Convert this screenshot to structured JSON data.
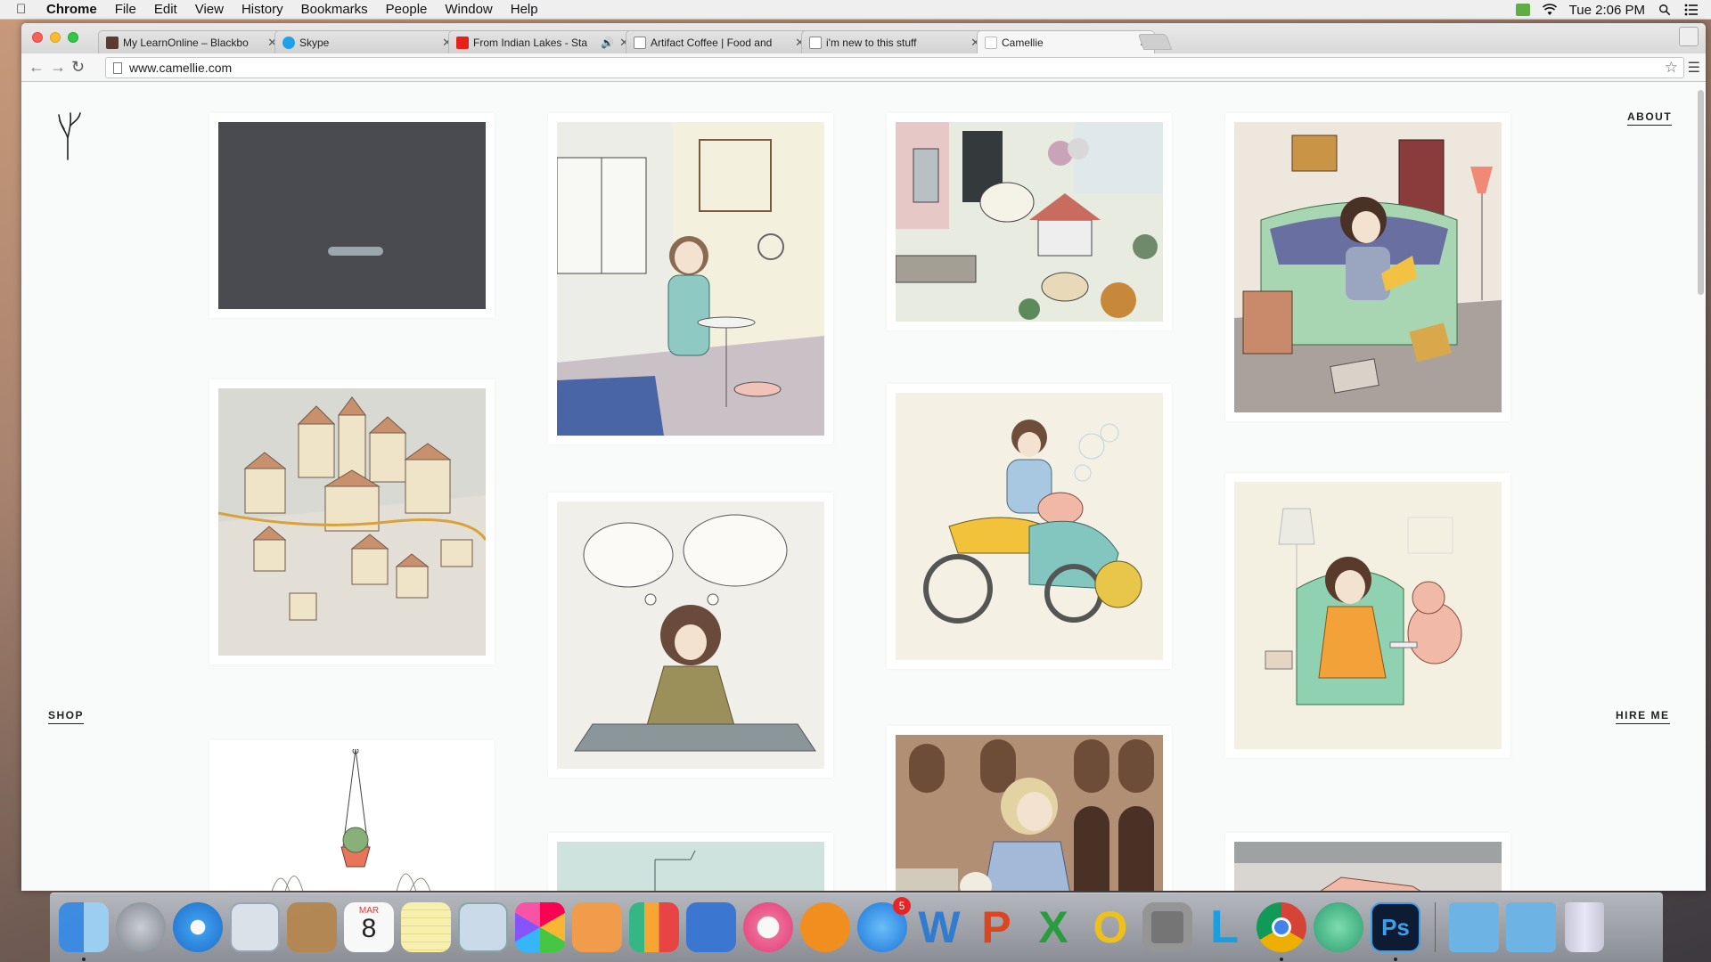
{
  "menubar": {
    "app": "Chrome",
    "items": [
      "File",
      "Edit",
      "View",
      "History",
      "Bookmarks",
      "People",
      "Window",
      "Help"
    ],
    "clock": "Tue 2:06 PM"
  },
  "tabs": [
    {
      "title": "My LearnOnline – Blackbo",
      "favicon_color": "#5a3b2e"
    },
    {
      "title": "Skype",
      "favicon_color": "#1ea1e6"
    },
    {
      "title": "From Indian Lakes - Sta",
      "favicon_color": "#e62117"
    },
    {
      "title": "Artifact Coffee | Food and",
      "favicon_color": "#ffffff"
    },
    {
      "title": "i'm new to this stuff",
      "favicon_color": "#ffffff"
    },
    {
      "title": "Camellie",
      "favicon_color": "#ffffff"
    }
  ],
  "toolbar": {
    "url": "www.camellie.com"
  },
  "site": {
    "about": "ABOUT",
    "shop": "SHOP",
    "hire": "HIRE ME"
  },
  "gallery": [
    {
      "subject": "loading-placeholder"
    },
    {
      "subject": "girl-tea-kitchen"
    },
    {
      "subject": "toy-room"
    },
    {
      "subject": "girl-sofa-laptop"
    },
    {
      "subject": "town-illustration"
    },
    {
      "subject": "meditating-girl"
    },
    {
      "subject": "motorbike-sidecar"
    },
    {
      "subject": "girl-armchair-bear"
    },
    {
      "subject": "hanging-plant"
    },
    {
      "subject": "window-sketch"
    },
    {
      "subject": "girl-street-dog"
    },
    {
      "subject": "rooftop-sketch"
    }
  ],
  "dock": {
    "calendar_month": "MAR",
    "calendar_day": "8",
    "appstore_badge": "5",
    "apps": [
      "finder",
      "launchpad",
      "safari",
      "mail",
      "contacts",
      "calendar",
      "notes",
      "preview",
      "photos",
      "pages",
      "numbers",
      "keynote",
      "itunes",
      "ibooks",
      "app-store",
      "word",
      "powerpoint",
      "excel",
      "outlook",
      "system-preferences",
      "lync",
      "chrome",
      "atom",
      "photoshop",
      "downloads-folder",
      "documents-folder",
      "trash"
    ]
  },
  "colors": {
    "page_bg": "#f8fbfa",
    "placeholder_bg": "#4a4b50"
  }
}
